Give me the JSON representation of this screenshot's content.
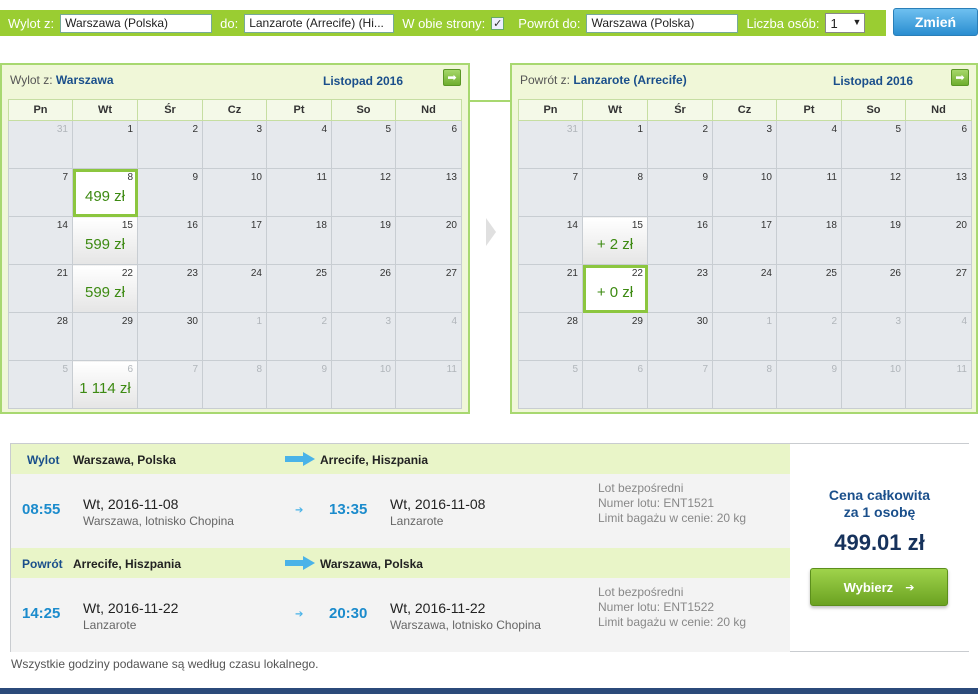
{
  "search": {
    "from_label": "Wylot z:",
    "from_value": "Warszawa (Polska)",
    "to_label": "do:",
    "to_value": "Lanzarote (Arrecife) (Hi...",
    "both_ways_label": "W obie strony:",
    "both_ways_checked": "✓",
    "return_label": "Powrót do:",
    "return_value": "Warszawa (Polska)",
    "persons_label": "Liczba osób:",
    "persons_value": "1",
    "change_button": "Zmień"
  },
  "weekdays": [
    "Pn",
    "Wt",
    "Śr",
    "Cz",
    "Pt",
    "So",
    "Nd"
  ],
  "outbound_calendar": {
    "title_prefix": "Wylot z:",
    "title_city": "Warszawa",
    "month": "Listopad 2016",
    "weeks": [
      [
        {
          "d": "31",
          "o": 1
        },
        {
          "d": "1"
        },
        {
          "d": "2"
        },
        {
          "d": "3"
        },
        {
          "d": "4"
        },
        {
          "d": "5"
        },
        {
          "d": "6"
        }
      ],
      [
        {
          "d": "7"
        },
        {
          "d": "8",
          "p": "499 zł",
          "s": 1
        },
        {
          "d": "9"
        },
        {
          "d": "10"
        },
        {
          "d": "11"
        },
        {
          "d": "12"
        },
        {
          "d": "13"
        }
      ],
      [
        {
          "d": "14"
        },
        {
          "d": "15",
          "p": "599 zł"
        },
        {
          "d": "16"
        },
        {
          "d": "17"
        },
        {
          "d": "18"
        },
        {
          "d": "19"
        },
        {
          "d": "20"
        }
      ],
      [
        {
          "d": "21"
        },
        {
          "d": "22",
          "p": "599 zł"
        },
        {
          "d": "23"
        },
        {
          "d": "24"
        },
        {
          "d": "25"
        },
        {
          "d": "26"
        },
        {
          "d": "27"
        }
      ],
      [
        {
          "d": "28"
        },
        {
          "d": "29"
        },
        {
          "d": "30"
        },
        {
          "d": "1",
          "o": 1
        },
        {
          "d": "2",
          "o": 1
        },
        {
          "d": "3",
          "o": 1
        },
        {
          "d": "4",
          "o": 1
        }
      ],
      [
        {
          "d": "5",
          "o": 1
        },
        {
          "d": "6",
          "o": 1,
          "p": "1 114 zł"
        },
        {
          "d": "7",
          "o": 1
        },
        {
          "d": "8",
          "o": 1
        },
        {
          "d": "9",
          "o": 1
        },
        {
          "d": "10",
          "o": 1
        },
        {
          "d": "11",
          "o": 1
        }
      ]
    ]
  },
  "return_calendar": {
    "title_prefix": "Powrót z:",
    "title_city": "Lanzarote (Arrecife)",
    "month": "Listopad 2016",
    "weeks": [
      [
        {
          "d": "31",
          "o": 1
        },
        {
          "d": "1"
        },
        {
          "d": "2"
        },
        {
          "d": "3"
        },
        {
          "d": "4"
        },
        {
          "d": "5"
        },
        {
          "d": "6"
        }
      ],
      [
        {
          "d": "7"
        },
        {
          "d": "8"
        },
        {
          "d": "9"
        },
        {
          "d": "10"
        },
        {
          "d": "11"
        },
        {
          "d": "12"
        },
        {
          "d": "13"
        }
      ],
      [
        {
          "d": "14"
        },
        {
          "d": "15",
          "p": "+ 2 zł"
        },
        {
          "d": "16"
        },
        {
          "d": "17"
        },
        {
          "d": "18"
        },
        {
          "d": "19"
        },
        {
          "d": "20"
        }
      ],
      [
        {
          "d": "21"
        },
        {
          "d": "22",
          "p": "+ 0 zł",
          "s": 1
        },
        {
          "d": "23"
        },
        {
          "d": "24"
        },
        {
          "d": "25"
        },
        {
          "d": "26"
        },
        {
          "d": "27"
        }
      ],
      [
        {
          "d": "28"
        },
        {
          "d": "29"
        },
        {
          "d": "30"
        },
        {
          "d": "1",
          "o": 1
        },
        {
          "d": "2",
          "o": 1
        },
        {
          "d": "3",
          "o": 1
        },
        {
          "d": "4",
          "o": 1
        }
      ],
      [
        {
          "d": "5",
          "o": 1
        },
        {
          "d": "6",
          "o": 1
        },
        {
          "d": "7",
          "o": 1
        },
        {
          "d": "8",
          "o": 1
        },
        {
          "d": "9",
          "o": 1
        },
        {
          "d": "10",
          "o": 1
        },
        {
          "d": "11",
          "o": 1
        }
      ]
    ]
  },
  "outbound": {
    "kind": "Wylot",
    "from": "Warszawa, Polska",
    "to": "Arrecife, Hiszpania",
    "dep_time": "08:55",
    "dep_date": "Wt, 2016-11-08",
    "dep_place": "Warszawa, lotnisko Chopina",
    "arr_time": "13:35",
    "arr_date": "Wt, 2016-11-08",
    "arr_place": "Lanzarote",
    "info1": "Lot bezpośredni",
    "info2": "Numer lotu: ENT1521",
    "info3": "Limit bagażu w cenie: 20 kg"
  },
  "inbound": {
    "kind": "Powrót",
    "from": "Arrecife, Hiszpania",
    "to": "Warszawa, Polska",
    "dep_time": "14:25",
    "dep_date": "Wt, 2016-11-22",
    "dep_place": "Lanzarote",
    "arr_time": "20:30",
    "arr_date": "Wt, 2016-11-22",
    "arr_place": "Warszawa, lotnisko Chopina",
    "info1": "Lot bezpośredni",
    "info2": "Numer lotu: ENT1522",
    "info3": "Limit bagażu w cenie: 20 kg"
  },
  "total": {
    "label_line1": "Cena całkowita",
    "label_line2": "za 1 osobę",
    "price": "499.01 zł",
    "choose_button": "Wybierz"
  },
  "note": "Wszystkie godziny podawane są według czasu lokalnego."
}
